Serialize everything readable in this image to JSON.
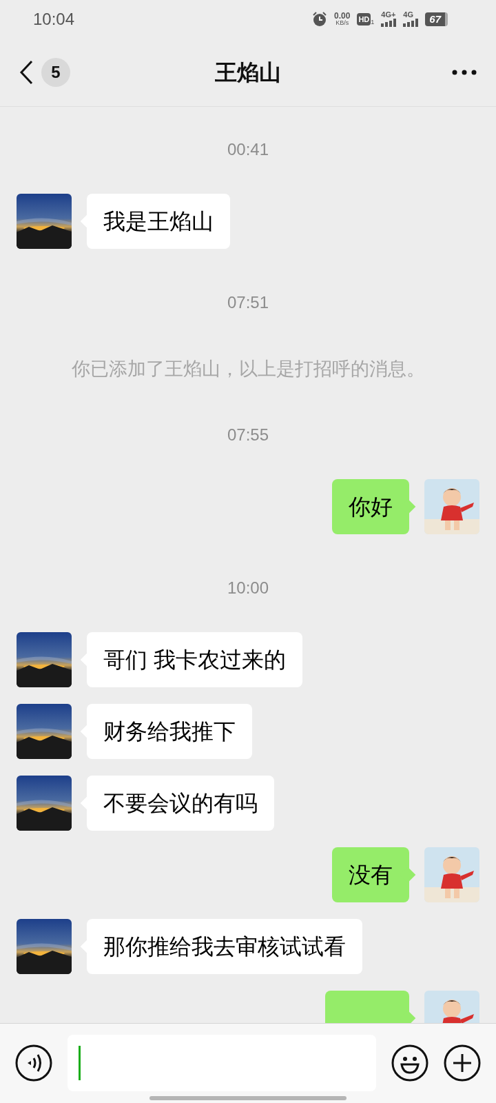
{
  "status_bar": {
    "time": "10:04",
    "speed_value": "0.00",
    "speed_unit": "KB/s",
    "hd_label": "HD",
    "hd_sub": "1",
    "sim1": "4G+",
    "sim2": "4G",
    "battery": "67"
  },
  "header": {
    "unread_count": "5",
    "title": "王焰山"
  },
  "chat": [
    {
      "kind": "time",
      "text": "00:41"
    },
    {
      "kind": "incoming",
      "text": "我是王焰山"
    },
    {
      "kind": "time",
      "text": "07:51"
    },
    {
      "kind": "notice",
      "text": "你已添加了王焰山，以上是打招呼的消息。"
    },
    {
      "kind": "time",
      "text": "07:55"
    },
    {
      "kind": "outgoing",
      "text": "你好"
    },
    {
      "kind": "time",
      "text": "10:00"
    },
    {
      "kind": "incoming",
      "text": "哥们 我卡农过来的"
    },
    {
      "kind": "incoming",
      "text": "财务给我推下"
    },
    {
      "kind": "incoming",
      "text": "不要会议的有吗"
    },
    {
      "kind": "outgoing",
      "text": "没有"
    },
    {
      "kind": "incoming",
      "text": "那你推给我去审核试试看"
    },
    {
      "kind": "outgoing_cut"
    }
  ]
}
